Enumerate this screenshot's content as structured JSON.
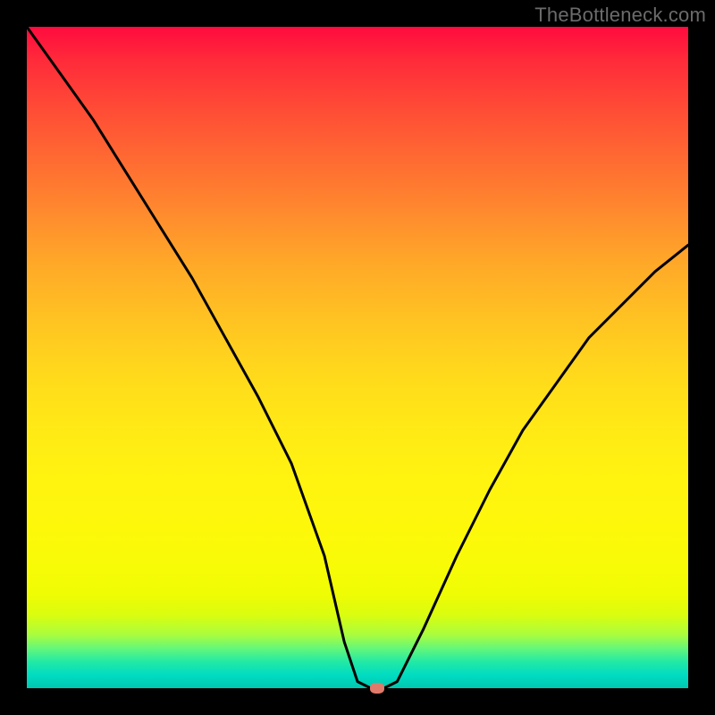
{
  "watermark": "TheBottleneck.com",
  "chart_data": {
    "type": "line",
    "title": "",
    "xlabel": "",
    "ylabel": "",
    "xlim": [
      0,
      100
    ],
    "ylim": [
      0,
      100
    ],
    "grid": false,
    "legend": false,
    "series": [
      {
        "name": "bottleneck-curve",
        "x": [
          0,
          5,
          10,
          15,
          20,
          25,
          30,
          35,
          40,
          45,
          48,
          50,
          52,
          54,
          56,
          60,
          65,
          70,
          75,
          80,
          85,
          90,
          95,
          100
        ],
        "y": [
          100,
          93,
          86,
          78,
          70,
          62,
          53,
          44,
          34,
          20,
          7,
          1,
          0,
          0,
          1,
          9,
          20,
          30,
          39,
          46,
          53,
          58,
          63,
          67
        ]
      }
    ],
    "marker": {
      "x": 53,
      "y": 0,
      "color": "#e07a6a"
    },
    "gradient_stops": [
      {
        "pos": 0,
        "color": "#ff0b3e"
      },
      {
        "pos": 50,
        "color": "#ffd81c"
      },
      {
        "pos": 85,
        "color": "#fdf80a"
      },
      {
        "pos": 100,
        "color": "#00c8b0"
      }
    ]
  }
}
